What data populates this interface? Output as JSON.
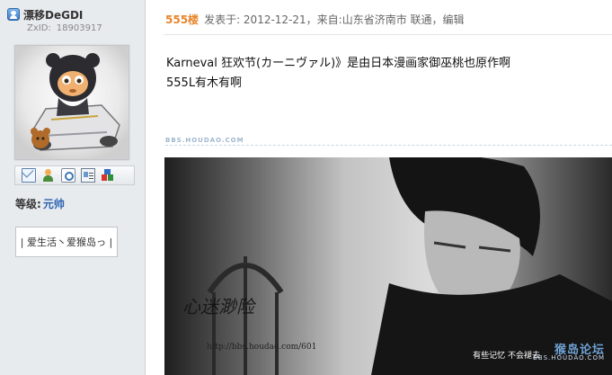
{
  "user": {
    "name": "漂移DeGDI",
    "id_label": "ZxID:",
    "id_value": "18903917",
    "rank_label": "等级:",
    "rank_value": "元帅",
    "signature": "| 爱生活丶爱猴岛っ |"
  },
  "actions": [
    {
      "name": "send-message",
      "icon": "mail-icon"
    },
    {
      "name": "add-friend",
      "icon": "add-friend-icon"
    },
    {
      "name": "view-profile",
      "icon": "search-icon"
    },
    {
      "name": "user-card",
      "icon": "id-card-icon"
    },
    {
      "name": "more",
      "icon": "blocks-icon"
    }
  ],
  "post": {
    "floor": "555楼",
    "meta": "发表于: 2012-12-21，来自:山东省济南市 联通，编辑",
    "lines": [
      "Karneval 狂欢节(カーニヴァル)》是由日本漫画家御巫桃也原作啊",
      "555L有木有啊"
    ],
    "watermark": "BBS.HOUDAO.COM"
  },
  "photo": {
    "handwriting": "心迷渺险",
    "caption": "http://bbs.houdao.com/601",
    "corner_text": "有些记忆 不会褪去",
    "logo_main": "猴岛论坛",
    "logo_sub": "BBS.HOUDAO.COM"
  },
  "colors": {
    "floor": "#e8842a",
    "rank": "#2a62b0",
    "sidebar_bg": "#e8ebee"
  }
}
